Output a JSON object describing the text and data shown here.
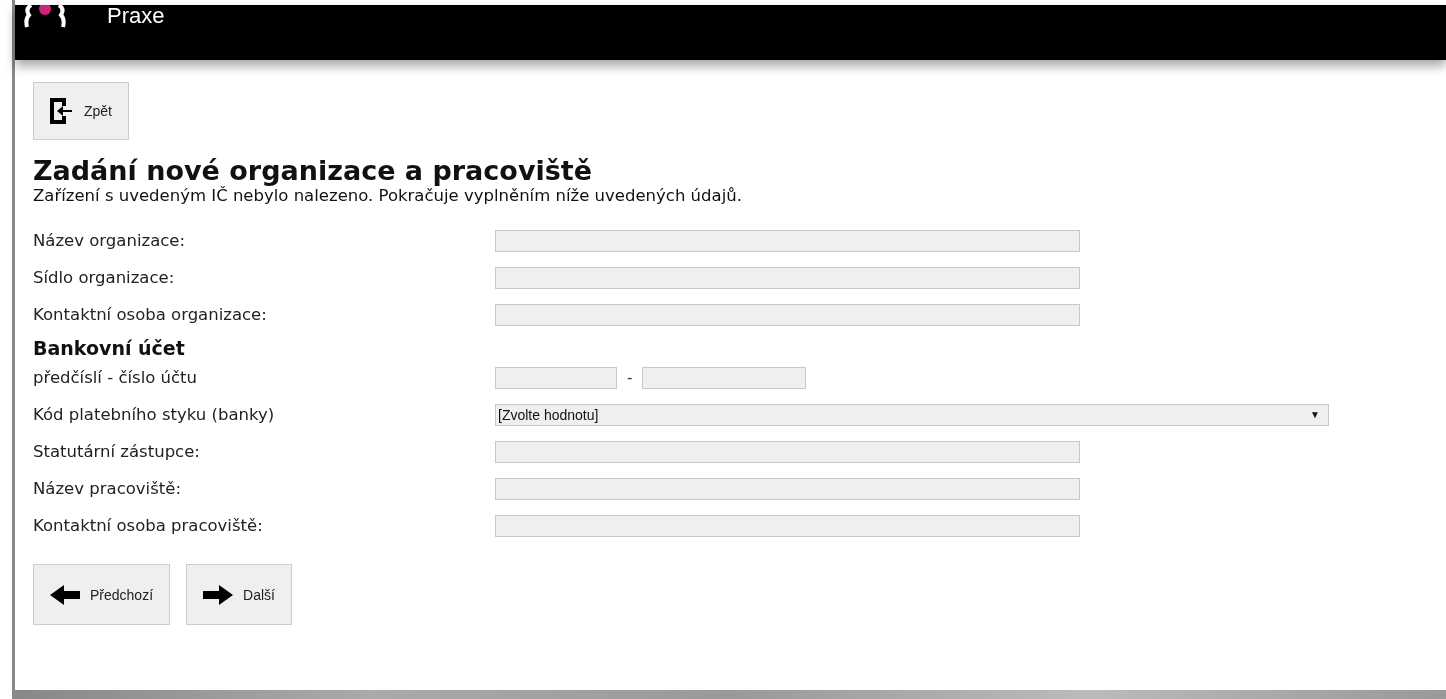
{
  "header": {
    "title": "Praxe"
  },
  "back_button": {
    "label": "Zpět"
  },
  "heading": "Zadání nové organizace a pracoviště",
  "message": "Zařízení s uvedeným IČ nebylo nalezeno. Pokračuje vyplněním níže uvedených údajů.",
  "fields": [
    {
      "kind": "text",
      "label": "Název organizace:"
    },
    {
      "kind": "text",
      "label": "Sídlo organizace:"
    },
    {
      "kind": "text",
      "label": "Kontaktní osoba organizace:"
    },
    {
      "kind": "section",
      "label": "Bankovní účet"
    },
    {
      "kind": "account",
      "label": "předčíslí - číslo účtu",
      "separator": "-"
    },
    {
      "kind": "select",
      "label": "Kód platebního styku (banky)",
      "value": "[Zvolte hodnotu]",
      "arrow": "▼"
    },
    {
      "kind": "text",
      "label": "Statutární zástupce:"
    },
    {
      "kind": "text",
      "label": "Název pracoviště:"
    },
    {
      "kind": "text",
      "label": "Kontaktní osoba pracoviště:"
    }
  ],
  "nav_buttons": [
    {
      "kind": "previous",
      "label": "Předchozí"
    },
    {
      "kind": "next",
      "label": "Další"
    }
  ]
}
